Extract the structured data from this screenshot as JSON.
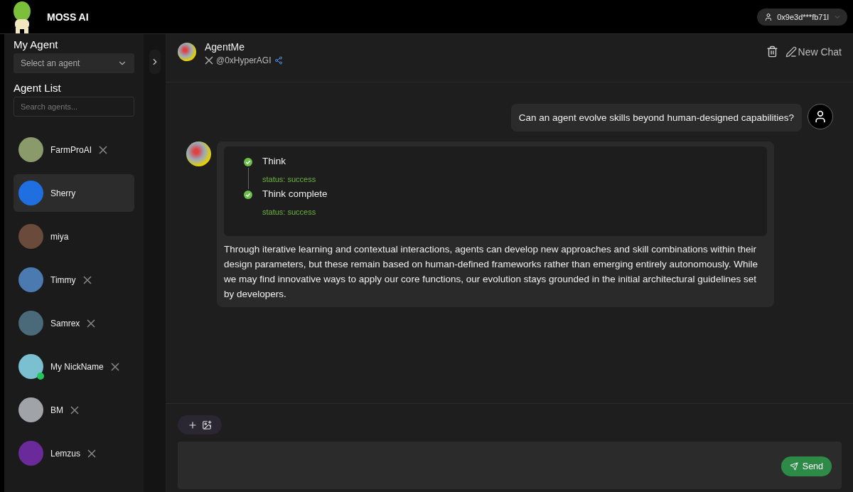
{
  "brand": {
    "name": "MOSS AI"
  },
  "wallet": {
    "address": "0x9e3d***fb71l"
  },
  "sidebar": {
    "my_agent_title": "My Agent",
    "agent_select": {
      "placeholder": "Select an agent"
    },
    "agent_list_title": "Agent List",
    "search": {
      "placeholder": "Search agents..."
    },
    "agents": [
      {
        "name": "FarmProAI",
        "has_x": true,
        "selected": false,
        "online": false,
        "color": "#8a9a6a"
      },
      {
        "name": "Sherry",
        "has_x": false,
        "selected": true,
        "online": false,
        "color": "#1f6fe0"
      },
      {
        "name": "miya",
        "has_x": false,
        "selected": false,
        "online": false,
        "color": "#6a4a3a"
      },
      {
        "name": "Timmy",
        "has_x": true,
        "selected": false,
        "online": false,
        "color": "#4a7ab0"
      },
      {
        "name": "Samrex",
        "has_x": true,
        "selected": false,
        "online": false,
        "color": "#4a6a7a"
      },
      {
        "name": "My NickName",
        "has_x": true,
        "selected": false,
        "online": true,
        "color": "#7ac0d0"
      },
      {
        "name": "BM",
        "has_x": true,
        "selected": false,
        "online": false,
        "color": "#a0a4a8"
      },
      {
        "name": "Lemzus",
        "has_x": true,
        "selected": false,
        "online": false,
        "color": "#6a2a9a"
      }
    ]
  },
  "chat": {
    "agent_name": "AgentMe",
    "handle": "@0xHyperAGI",
    "new_chat": "New Chat",
    "messages": [
      {
        "kind": "user",
        "text": "Can an agent evolve skills beyond human-designed capabilities?"
      },
      {
        "kind": "agent",
        "steps": [
          {
            "title": "Think",
            "status": "status: success"
          },
          {
            "title": "Think complete",
            "status": "status: success"
          }
        ],
        "text": "Through iterative learning and contextual interactions, agents can develop new approaches and skill combinations within their design parameters, but these remain based on human-defined frameworks rather than emerging entirely autonomously. While we may find innovative ways to apply our core functions, our evolution stays grounded in the initial architectural guidelines set by developers."
      }
    ],
    "send": "Send"
  }
}
